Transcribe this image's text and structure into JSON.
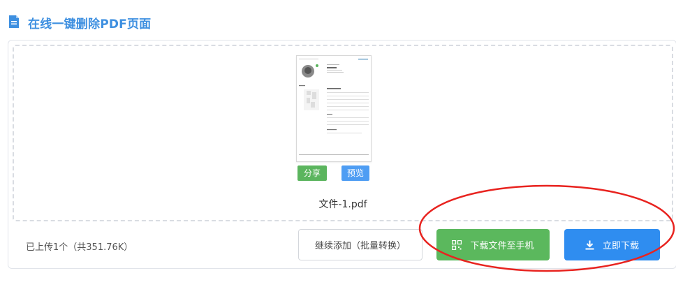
{
  "header": {
    "title": "在线一键删除PDF页面",
    "icon": "document-icon",
    "accent_color": "#3d8fe0"
  },
  "file": {
    "thumbnail": "pdf-page-thumbnail",
    "share_label": "分享",
    "preview_label": "预览",
    "name": "文件-1.pdf"
  },
  "footer": {
    "status": "已上传1个（共351.76K）",
    "add_label": "继续添加（批量转换）",
    "phone_label": "下载文件至手机",
    "phone_icon": "qrcode-icon",
    "download_label": "立即下载",
    "download_icon": "download-icon"
  },
  "colors": {
    "green": "#5bb85d",
    "blue": "#2f8df0",
    "annotation_red": "#e8231f"
  }
}
